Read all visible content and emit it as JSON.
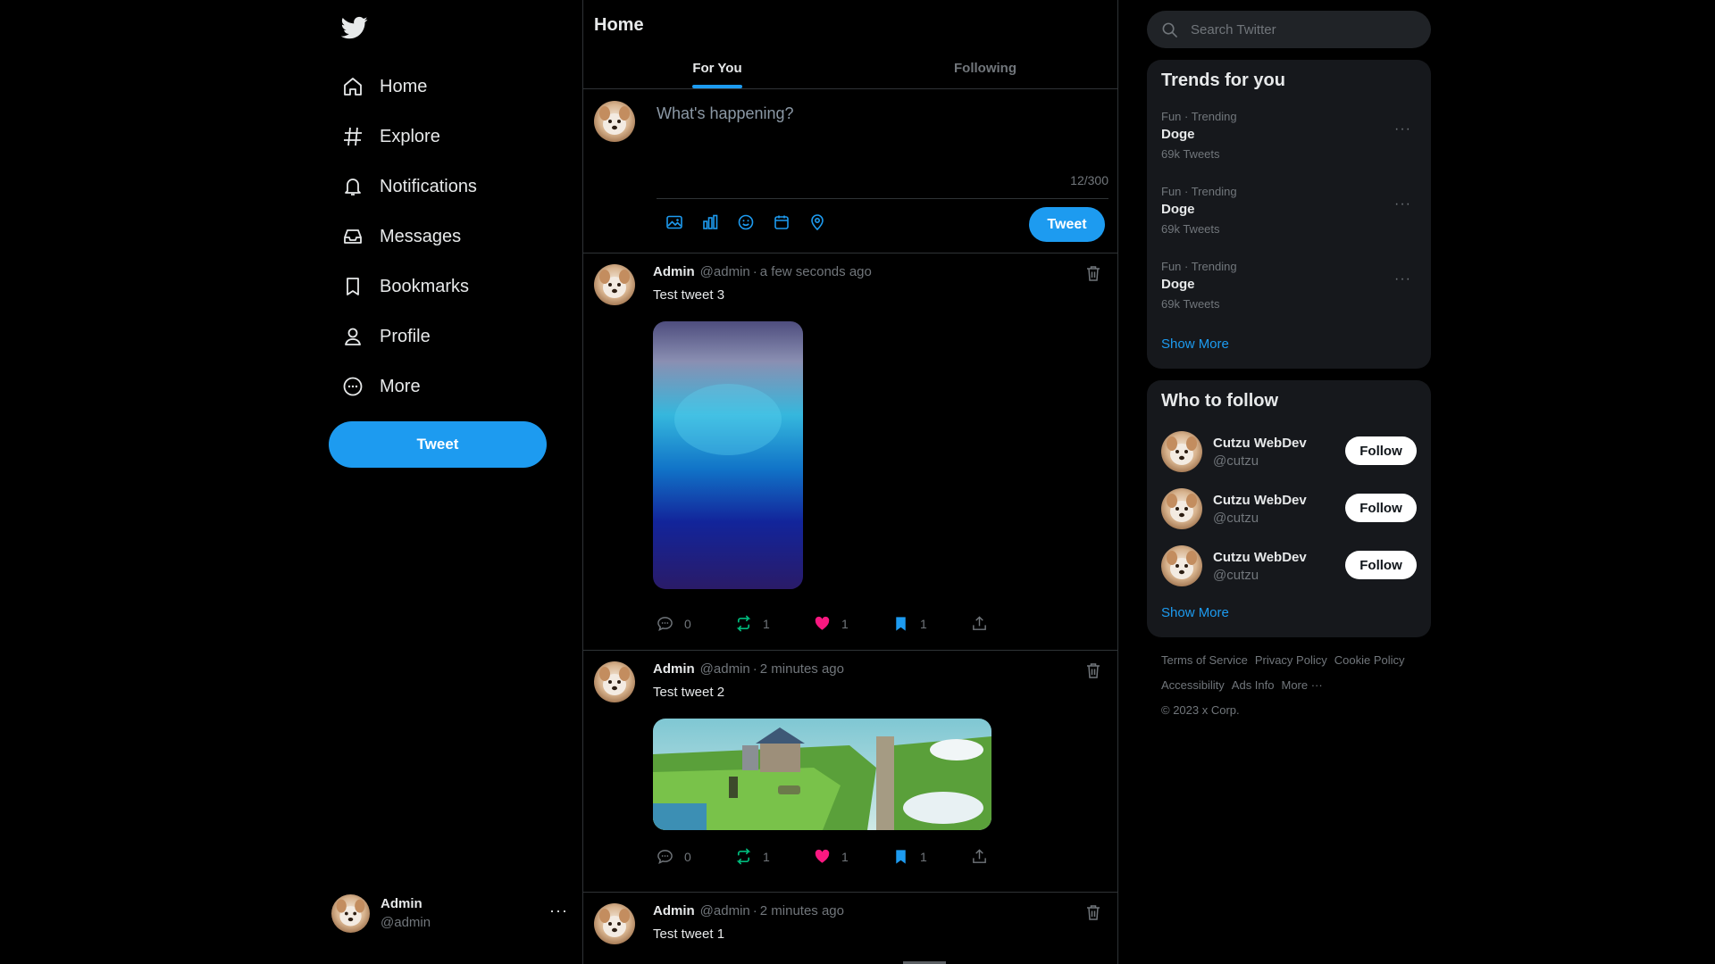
{
  "nav": {
    "items": [
      {
        "label": "Home",
        "icon": "home-icon"
      },
      {
        "label": "Explore",
        "icon": "hashtag-icon"
      },
      {
        "label": "Notifications",
        "icon": "bell-icon"
      },
      {
        "label": "Messages",
        "icon": "inbox-icon"
      },
      {
        "label": "Bookmarks",
        "icon": "bookmark-icon"
      },
      {
        "label": "Profile",
        "icon": "person-icon"
      },
      {
        "label": "More",
        "icon": "more-circle-icon"
      }
    ],
    "tweet_label": "Tweet",
    "account": {
      "name": "Admin",
      "handle": "@admin",
      "more": "···"
    }
  },
  "main": {
    "title": "Home",
    "tabs": [
      {
        "label": "For You",
        "active": true
      },
      {
        "label": "Following",
        "active": false
      }
    ],
    "compose": {
      "placeholder": "What's happening?",
      "counter": "12/300",
      "tweet_label": "Tweet",
      "tools": [
        "image-icon",
        "poll-icon",
        "emoji-icon",
        "schedule-icon",
        "location-icon"
      ]
    },
    "tweets": [
      {
        "name": "Admin",
        "handle": "@admin",
        "sep": "·",
        "time": "a few seconds ago",
        "text": "Test tweet 3",
        "replies": "0",
        "retweets": "1",
        "likes": "1",
        "bookmarks": "1"
      },
      {
        "name": "Admin",
        "handle": "@admin",
        "sep": "·",
        "time": "2 minutes ago",
        "text": "Test tweet 2",
        "replies": "0",
        "retweets": "1",
        "likes": "1",
        "bookmarks": "1"
      },
      {
        "name": "Admin",
        "handle": "@admin",
        "sep": "·",
        "time": "2 minutes ago",
        "text": "Test tweet 1"
      }
    ]
  },
  "right": {
    "search_placeholder": "Search Twitter",
    "trends": {
      "title": "Trends for you",
      "items": [
        {
          "meta": "Fun · Trending",
          "title": "Doge",
          "count": "69k Tweets"
        },
        {
          "meta": "Fun · Trending",
          "title": "Doge",
          "count": "69k Tweets"
        },
        {
          "meta": "Fun · Trending",
          "title": "Doge",
          "count": "69k Tweets"
        }
      ],
      "more_dots": "···",
      "show_more": "Show More"
    },
    "who_to_follow": {
      "title": "Who to follow",
      "items": [
        {
          "name": "Cutzu WebDev",
          "handle": "@cutzu",
          "button": "Follow"
        },
        {
          "name": "Cutzu WebDev",
          "handle": "@cutzu",
          "button": "Follow"
        },
        {
          "name": "Cutzu WebDev",
          "handle": "@cutzu",
          "button": "Follow"
        }
      ],
      "show_more": "Show More"
    },
    "footer": {
      "links": [
        "Terms of Service",
        "Privacy Policy",
        "Cookie Policy",
        "Accessibility",
        "Ads Info",
        "More ···"
      ],
      "copyright": "© 2023 x Corp."
    }
  },
  "colors": {
    "accent": "#1d9bf0",
    "like": "#f91880",
    "retweet": "#00ba7c",
    "bookmark": "#1d9bf0",
    "background": "#000000",
    "card": "#16181c"
  }
}
